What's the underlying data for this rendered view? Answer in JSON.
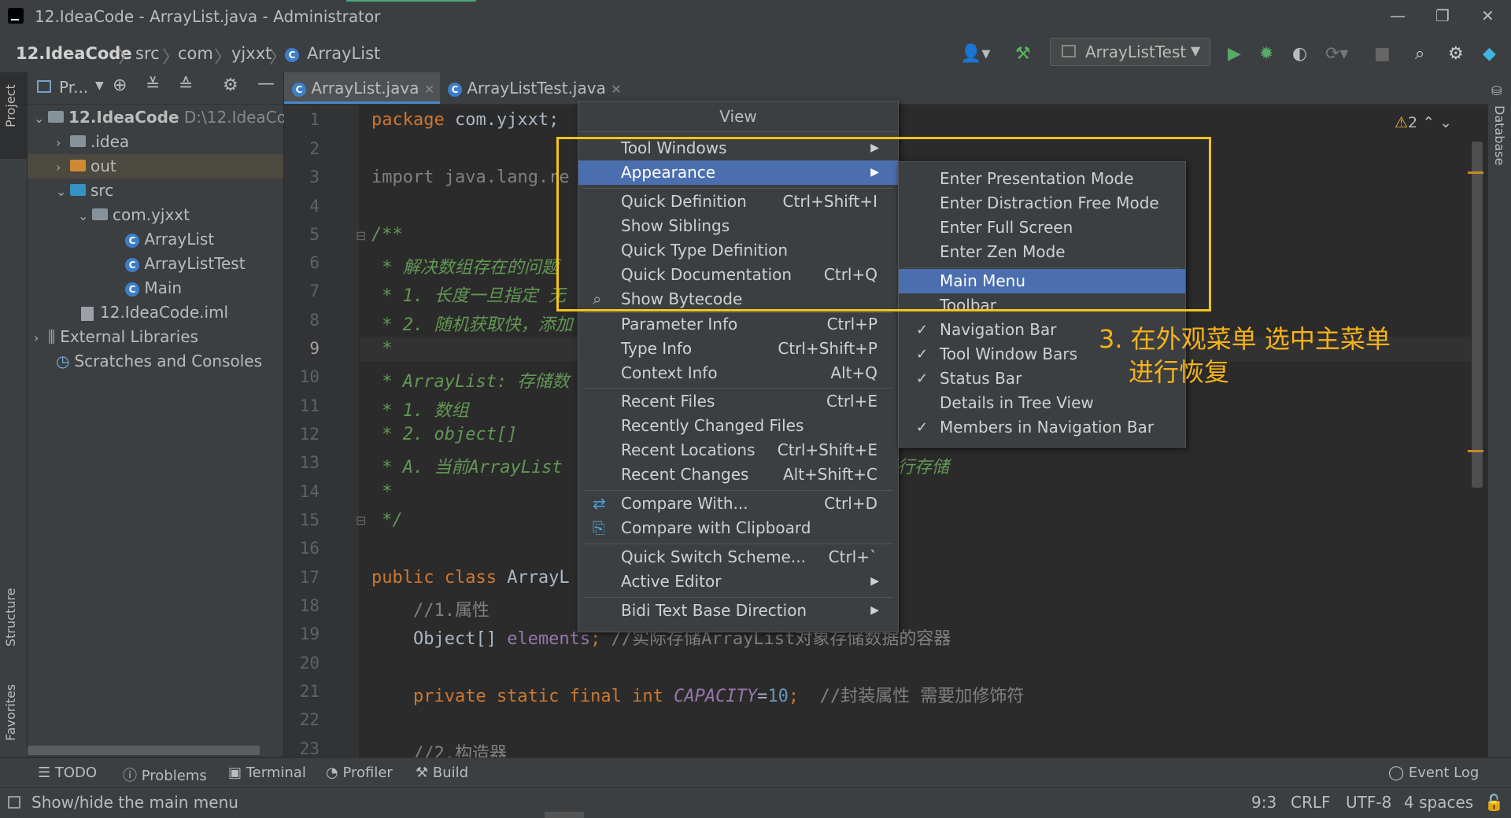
{
  "window": {
    "title": "12.IdeaCode - ArrayList.java - Administrator",
    "controls": [
      "—",
      "❐",
      "✕"
    ]
  },
  "breadcrumb": [
    "12.IdeaCode",
    "src",
    "com",
    "yjxxt",
    "ArrayList"
  ],
  "toolbar": {
    "run_config": "ArrayListTest"
  },
  "left_strip": {
    "project": "Project",
    "structure": "Structure",
    "favorites": "Favorites"
  },
  "right_strip": {
    "database": "Database"
  },
  "project_panel": {
    "header": "Pr...",
    "tree": [
      {
        "label": "12.IdeaCode",
        "extra": "D:\\12.IdeaCo",
        "depth": 0,
        "expanded": true,
        "kind": "module"
      },
      {
        "label": ".idea",
        "depth": 1,
        "expanded": false,
        "kind": "folder"
      },
      {
        "label": "out",
        "depth": 1,
        "expanded": false,
        "kind": "folder-orange",
        "selected": true
      },
      {
        "label": "src",
        "depth": 1,
        "expanded": true,
        "kind": "folder-blue"
      },
      {
        "label": "com.yjxxt",
        "depth": 2,
        "expanded": true,
        "kind": "package"
      },
      {
        "label": "ArrayList",
        "depth": 3,
        "kind": "class"
      },
      {
        "label": "ArrayListTest",
        "depth": 3,
        "kind": "class-run"
      },
      {
        "label": "Main",
        "depth": 3,
        "kind": "class-run"
      },
      {
        "label": "12.IdeaCode.iml",
        "depth": 2,
        "kind": "file"
      },
      {
        "label": "External Libraries",
        "depth": 0,
        "expanded": false,
        "kind": "libraries"
      },
      {
        "label": "Scratches and Consoles",
        "depth": 0,
        "kind": "scratches"
      }
    ]
  },
  "editor": {
    "tabs": [
      {
        "label": "ArrayList.java",
        "active": true
      },
      {
        "label": "ArrayListTest.java",
        "active": false
      }
    ],
    "warnings": "2",
    "line_numbers": [
      "1",
      "2",
      "3",
      "4",
      "5",
      "6",
      "7",
      "8",
      "9",
      "10",
      "11",
      "12",
      "13",
      "14",
      "15",
      "16",
      "17",
      "18",
      "19",
      "20",
      "21",
      "22",
      "23"
    ],
    "lines": {
      "l1_kw": "package",
      "l1_rest": " com.yjxxt;",
      "l3_kw": "import",
      "l3_rest": " java.lang.re",
      "l5": "/**",
      "l6": " * 解决数组存在的问题",
      "l7": " * 1. 长度一旦指定 无",
      "l8": " * 2. 随机获取快，添加",
      "l9": " *",
      "l10": " * ArrayList: 存储数",
      "l11": " * 1. 数组",
      "l12": " * 2. object[]",
      "l13a": " * A. 当前ArrayList",
      "l13b": "行存储",
      "l14": " *",
      "l15": " */",
      "l17_kw": "public class",
      "l17_rest": " ArrayL",
      "l18": "    //1.属性",
      "l19_a": "    Object[] ",
      "l19_fld": "elements",
      "l19_b": "; ",
      "l19_cm": "//实际存储ArrayList对象存储数据的容器",
      "l21_kw": "    private static final int ",
      "l21_cst": "CAPACITY",
      "l21_eq": "=",
      "l21_num": "10",
      "l21_semi": ";  ",
      "l21_cm": "//封装属性 需要加修饰符",
      "l23": "    //2.构造器"
    }
  },
  "view_menu": {
    "title": "View",
    "items": [
      {
        "label": "Tool Windows",
        "shortcut": "",
        "submenu": true
      },
      {
        "label": "Appearance",
        "shortcut": "",
        "submenu": true,
        "highlighted": true
      },
      {
        "label": "Quick Definition",
        "shortcut": "Ctrl+Shift+I"
      },
      {
        "label": "Show Siblings",
        "shortcut": ""
      },
      {
        "label": "Quick Type Definition",
        "shortcut": ""
      },
      {
        "label": "Quick Documentation",
        "shortcut": "Ctrl+Q"
      },
      {
        "label": "Show Bytecode",
        "shortcut": ""
      },
      {
        "label": "Parameter Info",
        "shortcut": "Ctrl+P"
      },
      {
        "label": "Type Info",
        "shortcut": "Ctrl+Shift+P"
      },
      {
        "label": "Context Info",
        "shortcut": "Alt+Q"
      },
      {
        "label": "Recent Files",
        "shortcut": "Ctrl+E"
      },
      {
        "label": "Recently Changed Files",
        "shortcut": ""
      },
      {
        "label": "Recent Locations",
        "shortcut": "Ctrl+Shift+E"
      },
      {
        "label": "Recent Changes",
        "shortcut": "Alt+Shift+C"
      },
      {
        "label": "Compare With...",
        "shortcut": "Ctrl+D"
      },
      {
        "label": "Compare with Clipboard",
        "shortcut": ""
      },
      {
        "label": "Quick Switch Scheme...",
        "shortcut": "Ctrl+`"
      },
      {
        "label": "Active Editor",
        "shortcut": "",
        "submenu": true
      },
      {
        "label": "Bidi Text Base Direction",
        "shortcut": "",
        "submenu": true
      }
    ]
  },
  "appearance_submenu": {
    "items": [
      {
        "label": "Enter Presentation Mode",
        "checked": false
      },
      {
        "label": "Enter Distraction Free Mode",
        "checked": false
      },
      {
        "label": "Enter Full Screen",
        "checked": false
      },
      {
        "label": "Enter Zen Mode",
        "checked": false
      },
      {
        "label": "Main Menu",
        "checked": false,
        "highlighted": true
      },
      {
        "label": "Toolbar",
        "checked": false
      },
      {
        "label": "Navigation Bar",
        "checked": true
      },
      {
        "label": "Tool Window Bars",
        "checked": true
      },
      {
        "label": "Status Bar",
        "checked": true
      },
      {
        "label": "Details in Tree View",
        "checked": false
      },
      {
        "label": "Members in Navigation Bar",
        "checked": true
      }
    ]
  },
  "annotation": {
    "line1": "3. 在外观菜单 选中主菜单",
    "line2": "进行恢复"
  },
  "tool_windows": {
    "todo": "TODO",
    "problems": "Problems",
    "terminal": "Terminal",
    "profiler": "Profiler",
    "build": "Build",
    "event_log": "Event Log"
  },
  "status_bar": {
    "message": "Show/hide the main menu",
    "position": "9:3",
    "line_sep": "CRLF",
    "encoding": "UTF-8",
    "indent": "4 spaces"
  },
  "colors": {
    "accent": "#4b6eaf",
    "annotation": "#f5b21b",
    "highlight_box": "#f5c518"
  }
}
